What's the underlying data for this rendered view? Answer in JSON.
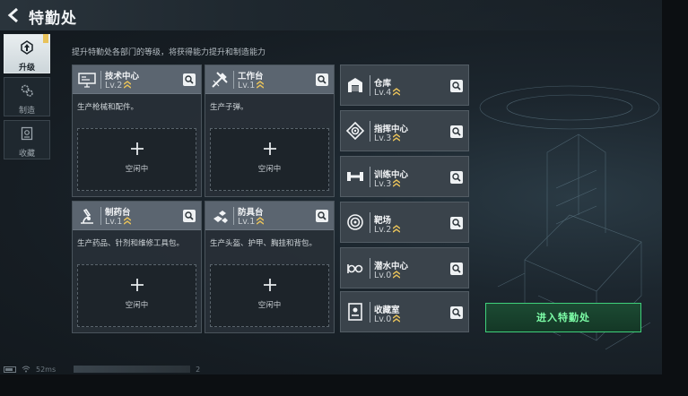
{
  "header": {
    "title": "特勤处"
  },
  "sidebar": {
    "tabs": [
      {
        "label": "升级",
        "icon": "upgrade-icon",
        "active": true,
        "badge": true
      },
      {
        "label": "制造",
        "icon": "gears-icon",
        "active": false
      },
      {
        "label": "收藏",
        "icon": "collection-icon",
        "active": false
      }
    ]
  },
  "subtitle": "提升特勤处各部门的等级，将获得能力提升和制造能力",
  "production": [
    {
      "name": "技术中心",
      "level": "Lv.2",
      "icon": "computer-icon",
      "desc": "生产枪械和配件。",
      "slot": "空闲中"
    },
    {
      "name": "工作台",
      "level": "Lv.1",
      "icon": "tools-icon",
      "desc": "生产子弹。",
      "slot": "空闲中"
    },
    {
      "name": "制药台",
      "level": "Lv.1",
      "icon": "microscope-icon",
      "desc": "生产药品、针剂和维修工具包。",
      "slot": "空闲中"
    },
    {
      "name": "防具台",
      "level": "Lv.1",
      "icon": "armor-icon",
      "desc": "生产头盔、护甲、胸挂和背包。",
      "slot": "空闲中"
    }
  ],
  "facilities": [
    {
      "name": "仓库",
      "level": "Lv.4",
      "icon": "warehouse-icon"
    },
    {
      "name": "指挥中心",
      "level": "Lv.3",
      "icon": "command-icon"
    },
    {
      "name": "训练中心",
      "level": "Lv.3",
      "icon": "dumbbell-icon"
    },
    {
      "name": "靶场",
      "level": "Lv.2",
      "icon": "target-icon"
    },
    {
      "name": "潜水中心",
      "level": "Lv.0",
      "icon": "diving-icon"
    },
    {
      "name": "收藏室",
      "level": "Lv.0",
      "icon": "trophy-room-icon"
    }
  ],
  "enter_button": "进入特勤处",
  "status": {
    "ping": "52ms",
    "uid_suffix": "2"
  },
  "colors": {
    "accent_green": "#3fd07a",
    "rank_gold": "#e8c25a",
    "badge": "#e8c25a"
  }
}
